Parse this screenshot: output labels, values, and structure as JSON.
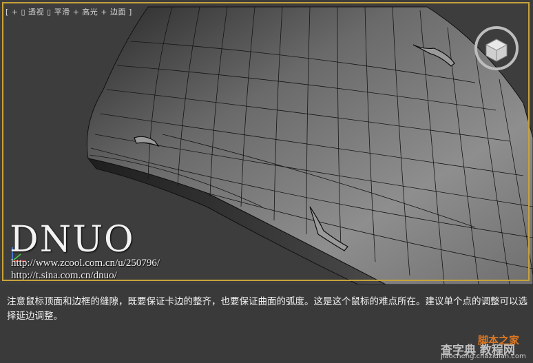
{
  "viewport": {
    "label": "[ + ▯ 透视 ▯ 平滑 + 高光 + 边面 ]",
    "frame_color": "#c8a23a",
    "viewcube_icon": "viewcube-icon"
  },
  "watermark": {
    "logo": "DNUO",
    "url1": "http://www.zcool.com.cn/u/250796/",
    "url2": "http://t.sina.com.cn/dnuo/"
  },
  "caption": {
    "text": "注意鼠标顶面和边框的缝隙，既要保证卡边的整齐，也要保证曲面的弧度。这是这个鼠标的难点所在。建议单个点的调整可以选择延边调整。"
  },
  "site_watermark": {
    "line1": "脚本之家",
    "line2": "查字典 教程网",
    "line3": "jiaocheng.chazidian.com"
  }
}
